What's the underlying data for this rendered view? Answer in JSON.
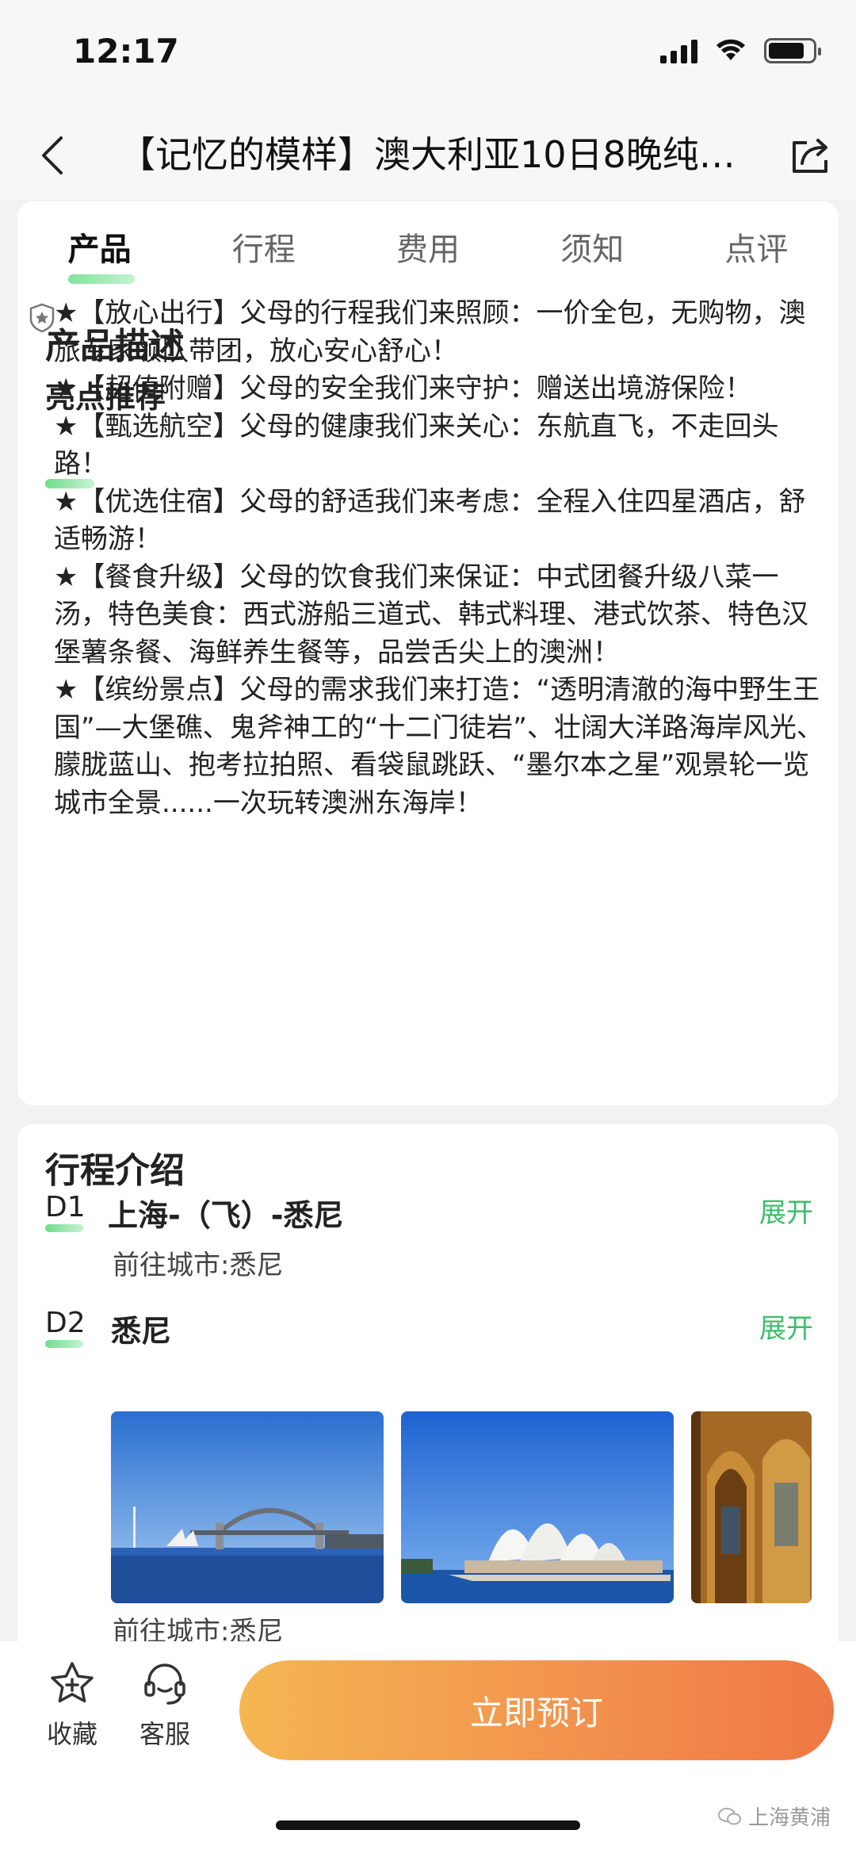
{
  "status_bar": {
    "time": "12:17"
  },
  "nav": {
    "title": "【记忆的模样】澳大利亚10日8晚纯…"
  },
  "tabs": [
    {
      "label": "产品",
      "active": true
    },
    {
      "label": "行程",
      "active": false
    },
    {
      "label": "费用",
      "active": false
    },
    {
      "label": "须知",
      "active": false
    },
    {
      "label": "点评",
      "active": false
    }
  ],
  "product": {
    "title": "产品描述",
    "highlights_title": "亮点推荐",
    "highlights_text": "★【放心出行】父母的行程我们来照顾：一价全包，无购物，澳旅专家领队带团，放心安心舒心！\n★【超值附赠】父母的安全我们来守护：赠送出境游保险！\n★【甄选航空】父母的健康我们来关心：东航直飞，不走回头路！\n★【优选住宿】父母的舒适我们来考虑：全程入住四星酒店，舒适畅游！\n★【餐食升级】父母的饮食我们来保证：中式团餐升级八菜一汤，特色美食：西式游船三道式、韩式料理、港式饮茶、特色汉堡薯条餐、海鲜养生餐等，品尝舌尖上的澳洲！\n★【缤纷景点】父母的需求我们来打造：“透明清澈的海中野生王国”—大堡礁、鬼斧神工的“十二门徒岩”、壮阔大洋路海岸风光、朦胧蓝山、抱考拉拍照、看袋鼠跳跃、“墨尔本之星”观景轮一览城市全景......一次玩转澳洲东海岸！"
  },
  "itinerary": {
    "title": "行程介绍",
    "days": [
      {
        "day": "D1",
        "title": "上海-（飞）-悉尼",
        "expand": "展开",
        "city": "前往城市:悉尼"
      },
      {
        "day": "D2",
        "title": "悉尼",
        "expand": "展开",
        "city": "前往城市:悉尼"
      }
    ]
  },
  "bottom": {
    "favorite": "收藏",
    "service": "客服",
    "book": "立即预订"
  },
  "watermark": "上海黄浦",
  "colors": {
    "accent_green": "#3bbf6a",
    "book_start": "#f5b652",
    "book_end": "#ef7843"
  }
}
